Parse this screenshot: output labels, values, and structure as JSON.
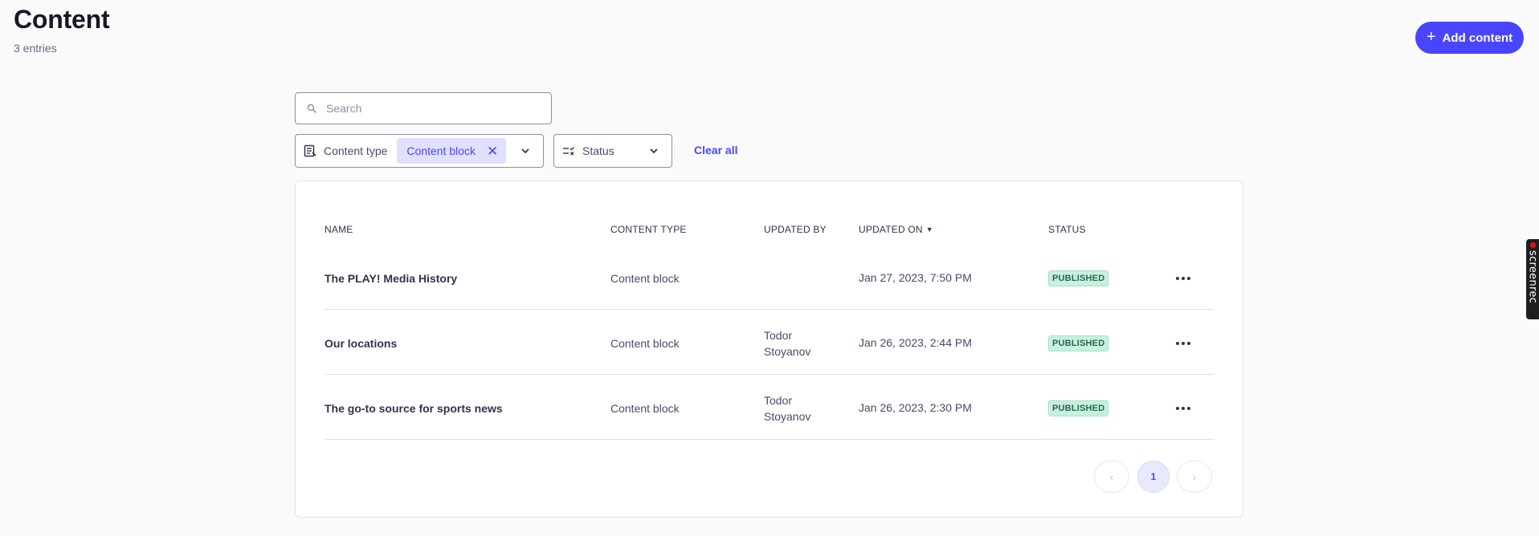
{
  "header": {
    "title": "Content",
    "entries": "3 entries",
    "add_button_label": "Add content",
    "add_button_icon": "plus-icon"
  },
  "search": {
    "placeholder": "Search",
    "value": ""
  },
  "filters": {
    "content_type": {
      "label": "Content type",
      "selected_tag": "Content block"
    },
    "status": {
      "label": "Status"
    },
    "clear_all": "Clear all"
  },
  "table": {
    "columns": {
      "name": "Name",
      "content_type": "Content type",
      "updated_by": "Updated by",
      "updated_on": "Updated on",
      "status": "Status"
    },
    "sorted_by": "updated_on",
    "rows": [
      {
        "name": "The PLAY! Media History",
        "content_type": "Content block",
        "updated_by_first": "",
        "updated_by_last": "",
        "updated_on": "Jan 27, 2023, 7:50 PM",
        "status": "PUBLISHED"
      },
      {
        "name": "Our locations",
        "content_type": "Content block",
        "updated_by_first": "Todor",
        "updated_by_last": "Stoyanov",
        "updated_on": "Jan 26, 2023, 2:44 PM",
        "status": "PUBLISHED"
      },
      {
        "name": "The go-to source for sports news",
        "content_type": "Content block",
        "updated_by_first": "Todor",
        "updated_by_last": "Stoyanov",
        "updated_on": "Jan 26, 2023, 2:30 PM",
        "status": "PUBLISHED"
      }
    ]
  },
  "pagination": {
    "current_page": "1",
    "prev_icon": "chevron-left-icon",
    "next_icon": "chevron-right-icon"
  },
  "overlay": {
    "screenrec_label": "screenrec"
  },
  "colors": {
    "accent": "#4945ff",
    "badge_bg": "#c6f0e2",
    "badge_text": "#2f6846"
  }
}
